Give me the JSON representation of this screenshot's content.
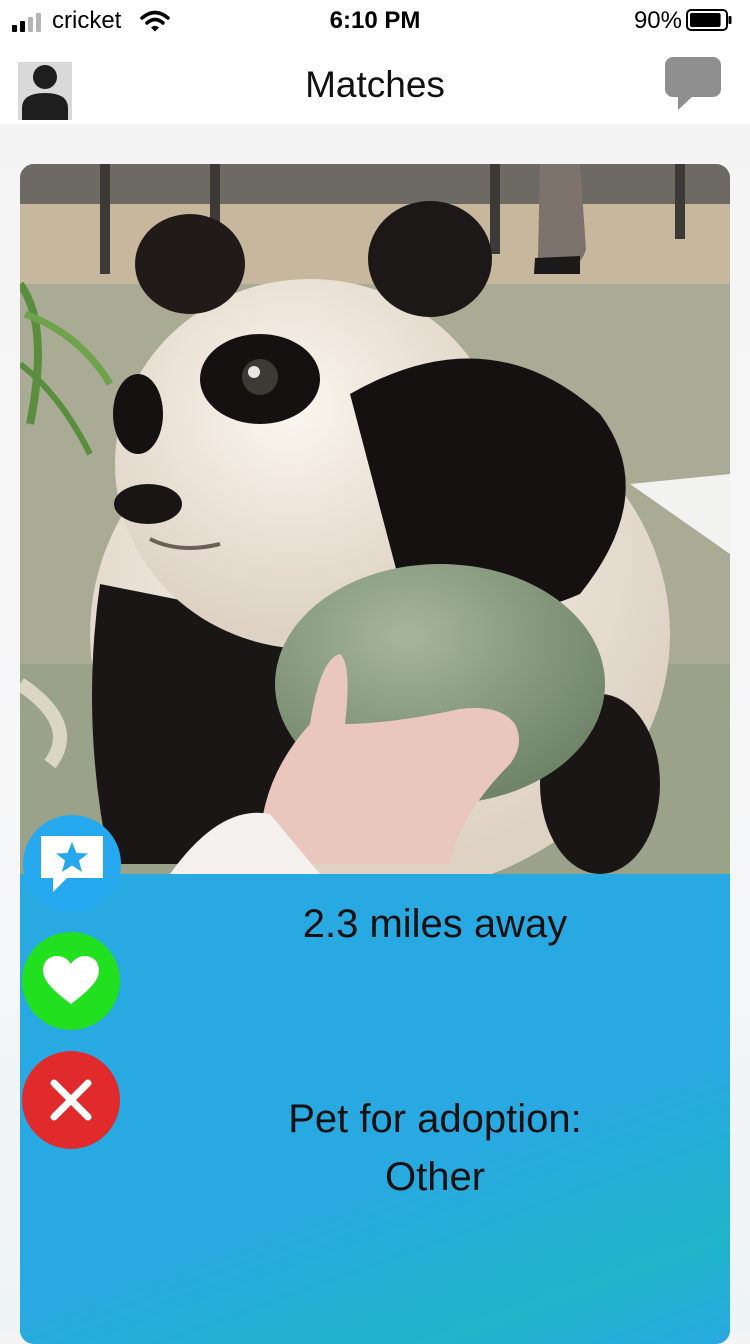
{
  "status_bar": {
    "carrier": "cricket",
    "time": "6:10 PM",
    "battery_percent": "90%",
    "battery_level": 0.9
  },
  "nav": {
    "title": "Matches",
    "left_icon": "profile-icon",
    "right_icon": "chat-bubble-icon"
  },
  "card": {
    "photo_subject": "panda cub holding a green ball",
    "distance": "2.3 miles away",
    "adoption_line1": "Pet for adoption:",
    "adoption_line2": "Other"
  },
  "actions": [
    {
      "name": "favorite",
      "icon": "star-speech-bubble-icon",
      "color": "#26a8ee"
    },
    {
      "name": "like",
      "icon": "heart-icon",
      "color": "#20e020"
    },
    {
      "name": "dismiss",
      "icon": "close-icon",
      "color": "#e02a2c"
    }
  ],
  "colors": {
    "panel_blue": "#29a9e1",
    "title_text": "#111111"
  }
}
